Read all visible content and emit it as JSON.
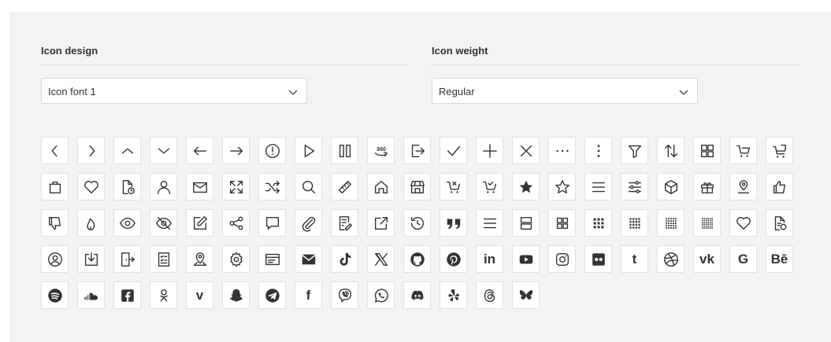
{
  "settings": {
    "icon_design": {
      "label": "Icon design",
      "value": "Icon font 1"
    },
    "icon_weight": {
      "label": "Icon weight",
      "value": "Regular"
    }
  },
  "icons": [
    {
      "name": "chevron-left-icon"
    },
    {
      "name": "chevron-right-icon"
    },
    {
      "name": "chevron-up-icon"
    },
    {
      "name": "chevron-down-icon"
    },
    {
      "name": "arrow-left-icon"
    },
    {
      "name": "arrow-right-icon"
    },
    {
      "name": "alert-circle-icon"
    },
    {
      "name": "play-icon"
    },
    {
      "name": "pause-icon"
    },
    {
      "name": "rotate-360-icon",
      "text": "360"
    },
    {
      "name": "sign-out-icon"
    },
    {
      "name": "check-icon"
    },
    {
      "name": "plus-icon"
    },
    {
      "name": "close-icon"
    },
    {
      "name": "more-horizontal-icon"
    },
    {
      "name": "more-vertical-icon"
    },
    {
      "name": "filter-icon"
    },
    {
      "name": "sort-icon"
    },
    {
      "name": "grid-icon"
    },
    {
      "name": "cart-icon"
    },
    {
      "name": "cart-alt-icon"
    },
    {
      "name": "shopping-bag-icon"
    },
    {
      "name": "heart-icon"
    },
    {
      "name": "document-clock-icon"
    },
    {
      "name": "user-icon"
    },
    {
      "name": "mail-icon"
    },
    {
      "name": "expand-icon"
    },
    {
      "name": "shuffle-icon"
    },
    {
      "name": "search-icon"
    },
    {
      "name": "ruler-icon"
    },
    {
      "name": "home-icon"
    },
    {
      "name": "store-icon"
    },
    {
      "name": "cart-remove-icon"
    },
    {
      "name": "cart-check-icon"
    },
    {
      "name": "star-filled-icon"
    },
    {
      "name": "star-icon"
    },
    {
      "name": "menu-icon"
    },
    {
      "name": "sliders-icon"
    },
    {
      "name": "box-icon"
    },
    {
      "name": "gift-icon"
    },
    {
      "name": "location-pin-icon"
    },
    {
      "name": "thumbs-up-icon"
    },
    {
      "name": "thumbs-down-icon"
    },
    {
      "name": "flame-icon"
    },
    {
      "name": "eye-icon"
    },
    {
      "name": "eye-off-icon"
    },
    {
      "name": "edit-icon"
    },
    {
      "name": "share-icon"
    },
    {
      "name": "comment-icon"
    },
    {
      "name": "paperclip-icon"
    },
    {
      "name": "document-edit-icon"
    },
    {
      "name": "external-link-icon"
    },
    {
      "name": "history-icon"
    },
    {
      "name": "quote-icon"
    },
    {
      "name": "list-icon"
    },
    {
      "name": "rows-icon"
    },
    {
      "name": "grid-2x2-icon"
    },
    {
      "name": "grid-3x3-icon"
    },
    {
      "name": "grid-4x4-icon"
    },
    {
      "name": "grid-5x5-icon"
    },
    {
      "name": "grid-6x6-icon"
    },
    {
      "name": "heart-alt-icon"
    },
    {
      "name": "document-time-icon"
    },
    {
      "name": "user-circle-icon"
    },
    {
      "name": "download-icon"
    },
    {
      "name": "door-exit-icon"
    },
    {
      "name": "checklist-icon"
    },
    {
      "name": "map-pin-icon"
    },
    {
      "name": "settings-icon"
    },
    {
      "name": "card-icon"
    },
    {
      "name": "envelope-filled-icon"
    },
    {
      "name": "tiktok-icon"
    },
    {
      "name": "x-twitter-icon"
    },
    {
      "name": "github-icon"
    },
    {
      "name": "pinterest-icon"
    },
    {
      "name": "linkedin-icon",
      "text": "in"
    },
    {
      "name": "youtube-icon"
    },
    {
      "name": "instagram-icon"
    },
    {
      "name": "flickr-icon"
    },
    {
      "name": "tumblr-icon",
      "text": "t"
    },
    {
      "name": "dribbble-icon"
    },
    {
      "name": "vk-icon",
      "text": "vk"
    },
    {
      "name": "google-icon",
      "text": "G"
    },
    {
      "name": "behance-icon",
      "text": "Bē"
    },
    {
      "name": "spotify-icon"
    },
    {
      "name": "soundcloud-icon"
    },
    {
      "name": "facebook-square-icon"
    },
    {
      "name": "odnoklassniki-icon"
    },
    {
      "name": "vimeo-icon",
      "text": "v"
    },
    {
      "name": "snapchat-icon"
    },
    {
      "name": "telegram-icon"
    },
    {
      "name": "facebook-icon",
      "text": "f"
    },
    {
      "name": "viber-icon"
    },
    {
      "name": "whatsapp-icon"
    },
    {
      "name": "discord-icon"
    },
    {
      "name": "yelp-icon"
    },
    {
      "name": "threads-icon"
    },
    {
      "name": "bluesky-icon"
    }
  ]
}
